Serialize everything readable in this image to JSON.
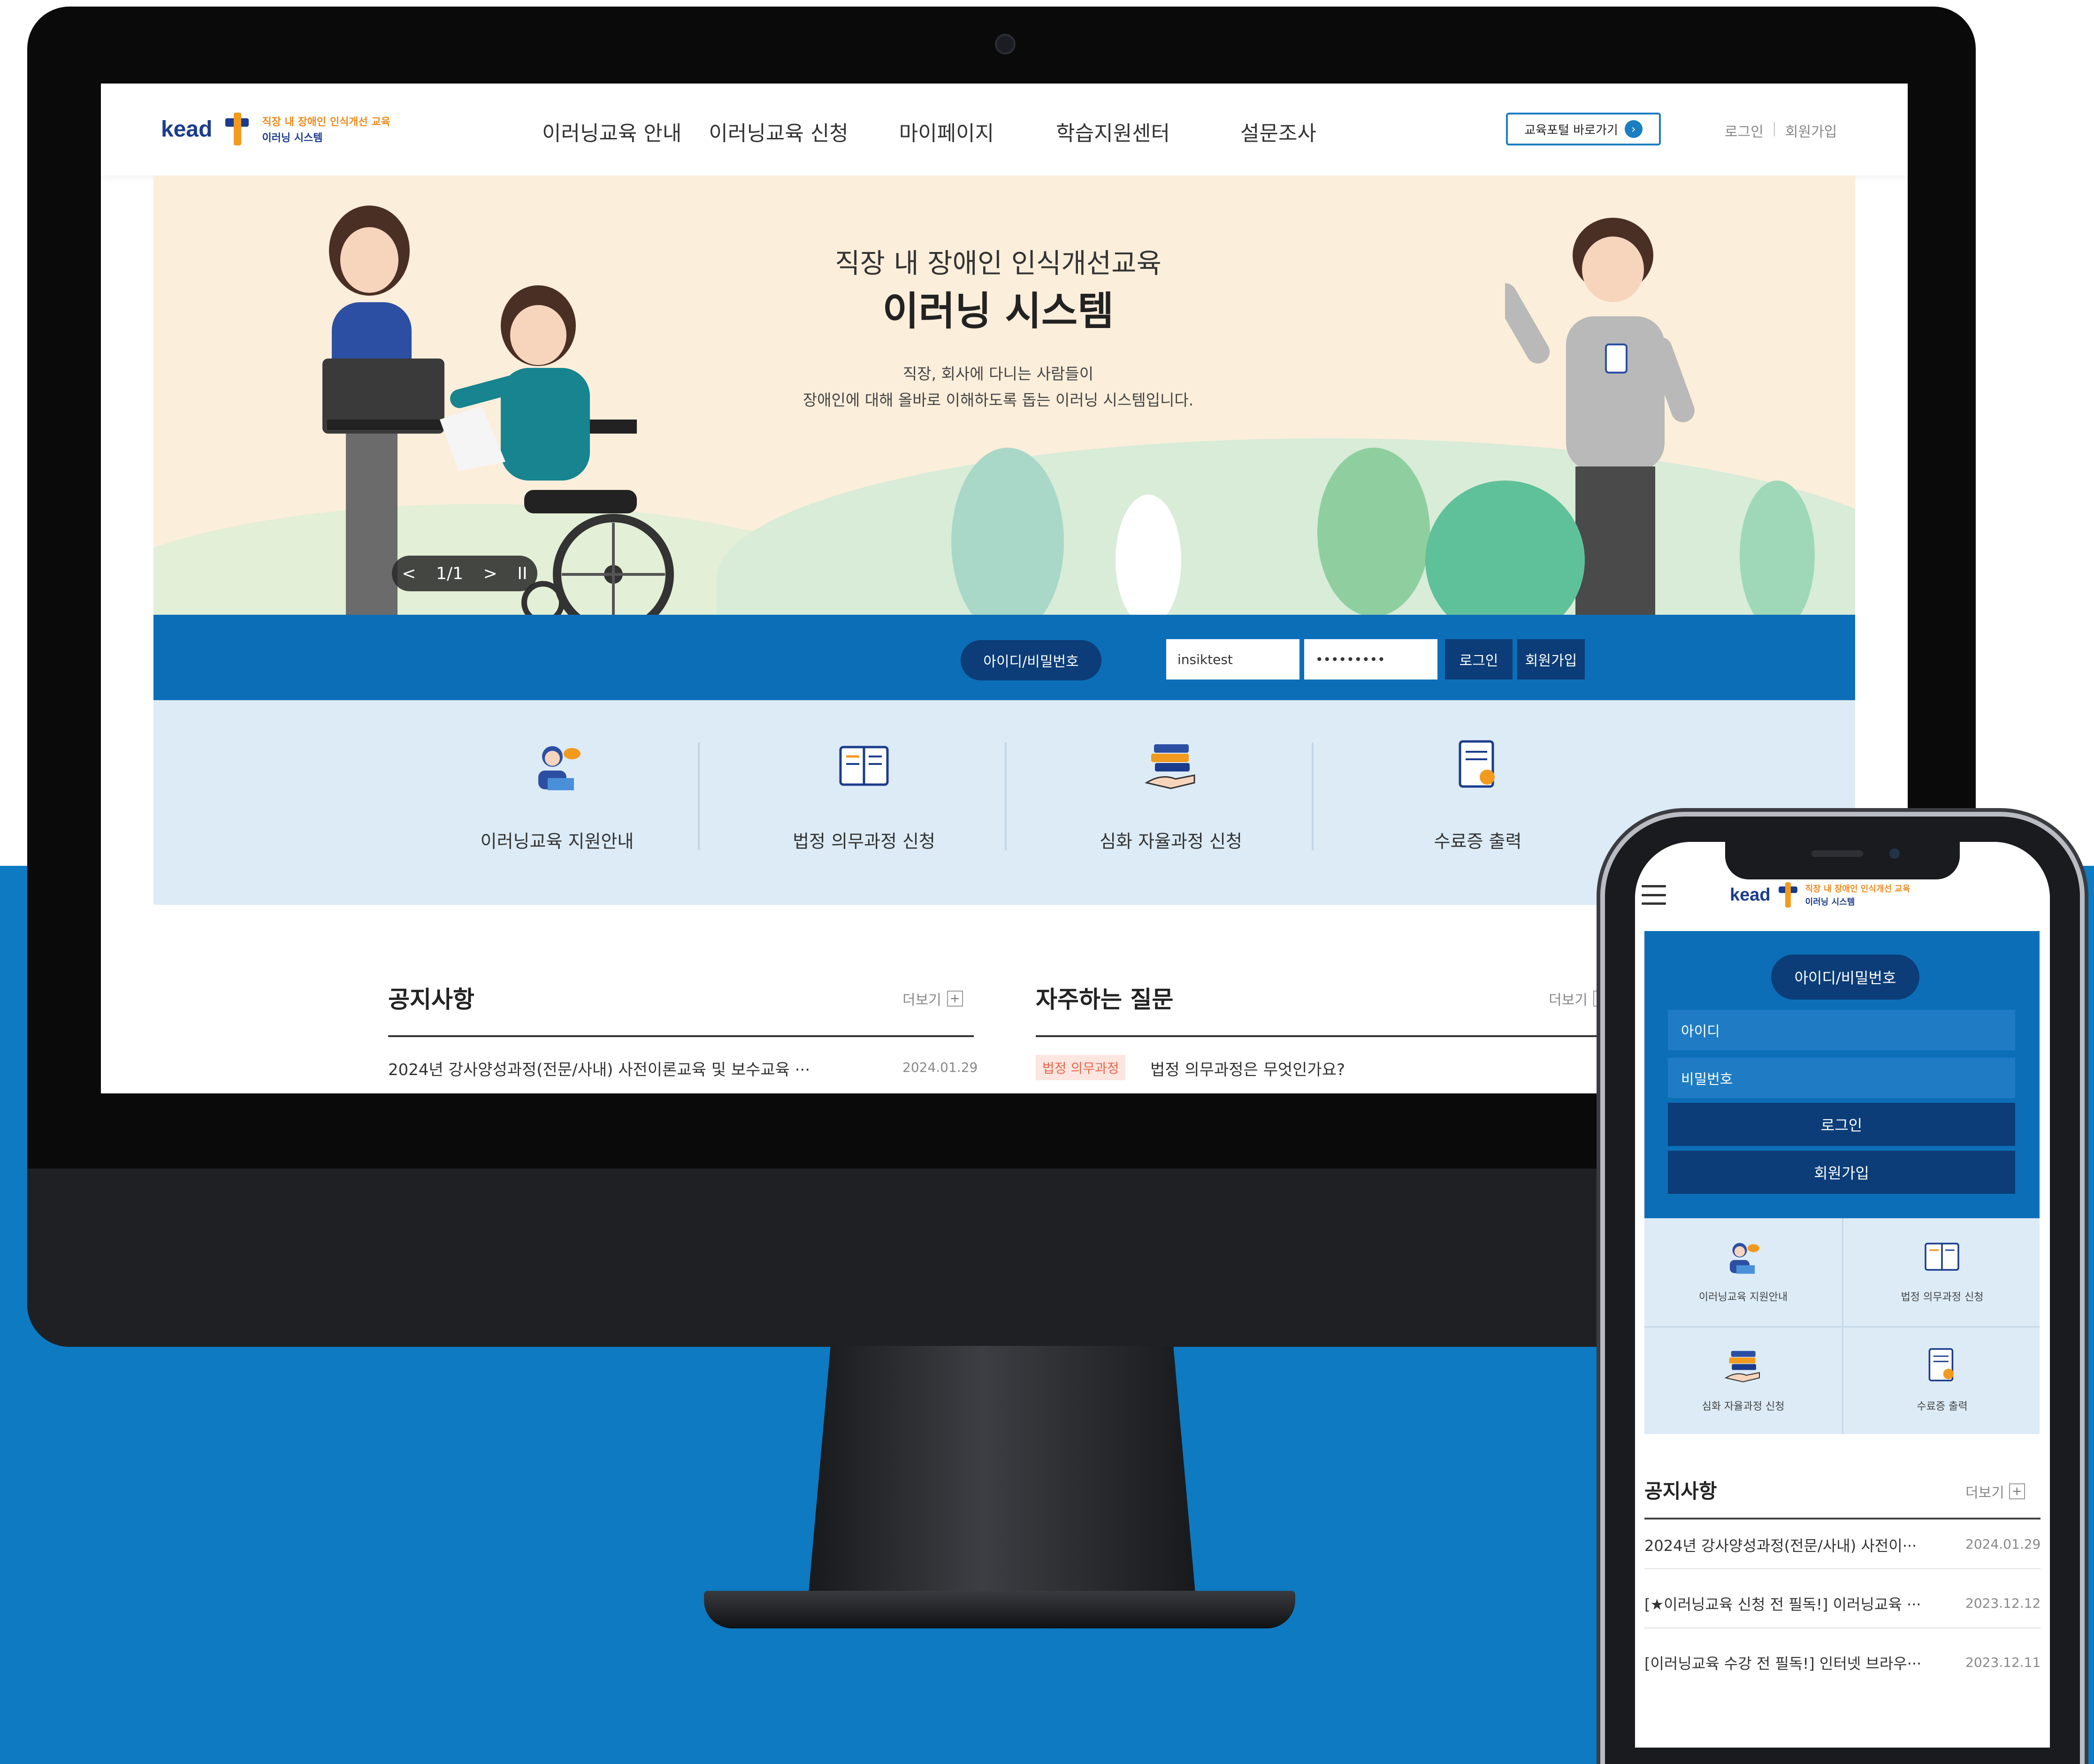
{
  "header": {
    "logo_text": "kead",
    "logo_line1": "직장 내 장애인 인식개선 교육",
    "logo_line2": "이러닝 시스템",
    "nav": [
      "이러닝교육 안내",
      "이러닝교육 신청",
      "마이페이지",
      "학습지원센터",
      "설문조사"
    ],
    "portal_button": "교육포털 바로가기",
    "login_link": "로그인",
    "join_link": "회원가입"
  },
  "hero": {
    "title_line1": "직장 내 장애인 인식개선교육",
    "title_line2": "이러닝 시스템",
    "subtitle_line1": "직장, 회사에 다니는 사람들이",
    "subtitle_line2": "장애인에 대해 올바로 이해하도록 돕는 이러닝 시스템입니다.",
    "slider_prev": "<",
    "slider_counter": "1/1",
    "slider_next": ">",
    "slider_pause": "II"
  },
  "login_bar": {
    "tab_label": "아이디/비밀번호",
    "id_value": "insiktest",
    "password_value": "•••••••••",
    "login_button": "로그인",
    "join_button": "회원가입"
  },
  "quick_menu": [
    {
      "label": "이러닝교육 지원안내",
      "icon": "support-agent-icon"
    },
    {
      "label": "법정 의무과정 신청",
      "icon": "book-icon"
    },
    {
      "label": "심화 자율과정 신청",
      "icon": "books-hand-icon"
    },
    {
      "label": "수료증 출력",
      "icon": "certificate-icon"
    }
  ],
  "notice": {
    "title": "공지사항",
    "more": "더보기",
    "first_item": "2024년 강사양성과정(전문/사내) 사전이론교육 및 보수교육 ···",
    "first_date": "2024.01.29"
  },
  "faq": {
    "title": "자주하는 질문",
    "more": "더보기",
    "first_tag": "법정 의무과정",
    "first_item": "법정 의무과정은 무엇인가요?"
  },
  "mobile": {
    "logo_text": "kead",
    "logo_line1": "직장 내 장애인 인식개선 교육",
    "logo_line2": "이러닝 시스템",
    "tab_label": "아이디/비밀번호",
    "id_placeholder": "아이디",
    "password_placeholder": "비밀번호",
    "login_button": "로그인",
    "join_button": "회원가입",
    "quick_menu": [
      {
        "label": "이러닝교육 지원안내",
        "icon": "support-agent-icon"
      },
      {
        "label": "법정 의무과정 신청",
        "icon": "book-icon"
      },
      {
        "label": "심화 자율과정 신청",
        "icon": "books-hand-icon"
      },
      {
        "label": "수료증 출력",
        "icon": "certificate-icon"
      }
    ],
    "notice_title": "공지사항",
    "notice_more": "더보기",
    "notices": [
      {
        "title": "2024년 강사양성과정(전문/사내) 사전이···",
        "date": "2024.01.29"
      },
      {
        "title": "[★이러닝교육 신청 전 필독!] 이러닝교육 ···",
        "date": "2023.12.12"
      },
      {
        "title": "[이러닝교육 수강 전 필독!] 인터넷 브라우···",
        "date": "2023.12.11"
      }
    ]
  },
  "colors": {
    "brand_blue": "#0d6eb8",
    "navy": "#0c3d78",
    "accent_orange": "#ef8a1d",
    "quick_bg": "#dcebf6",
    "hero_bg": "#fbeedb"
  }
}
